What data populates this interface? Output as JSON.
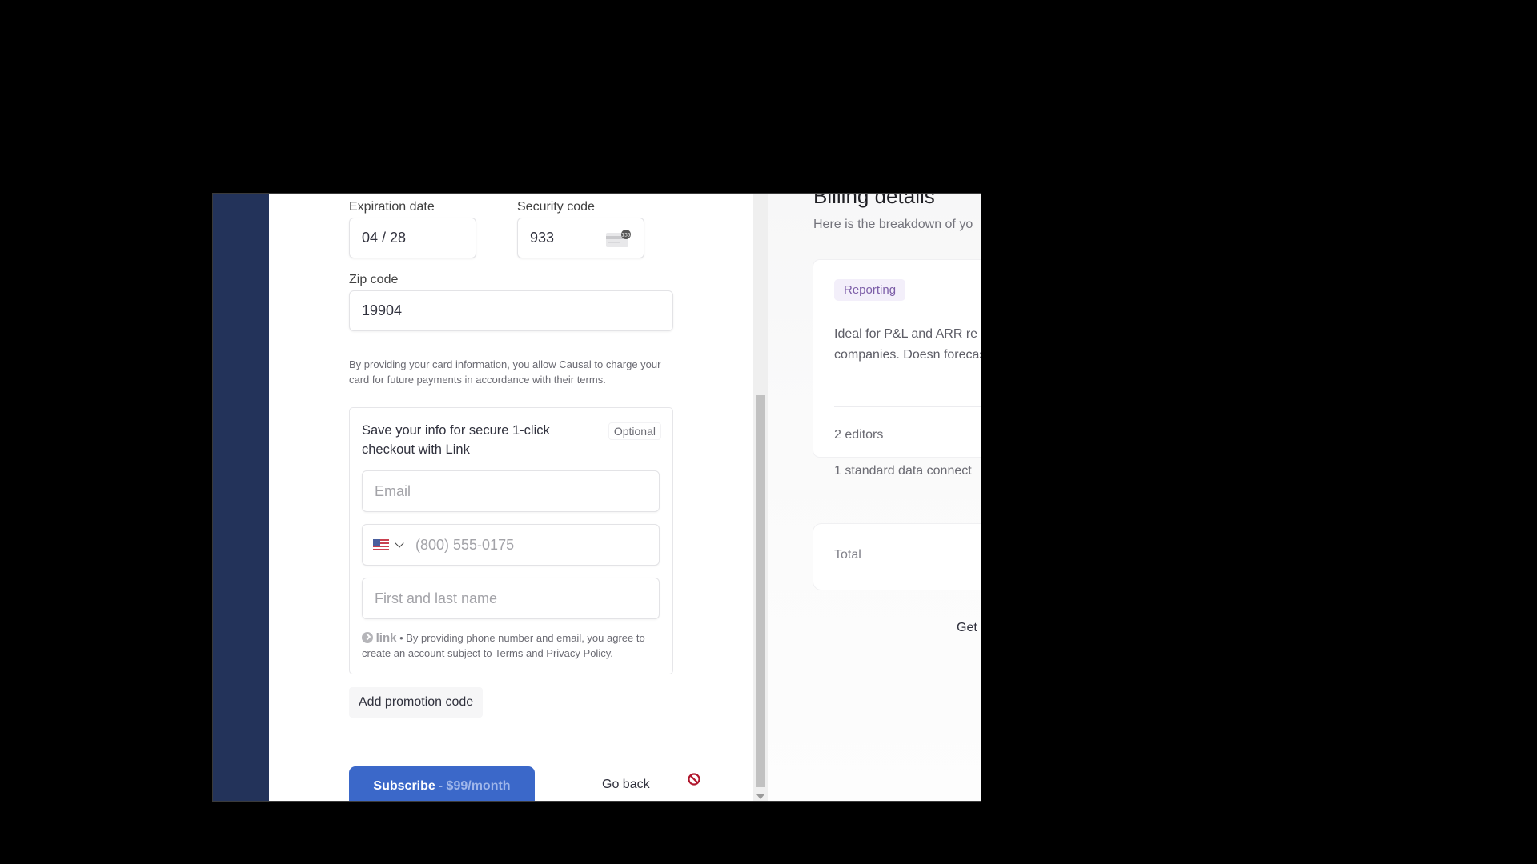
{
  "payment_form": {
    "expiration": {
      "label": "Expiration date",
      "value": "04 / 28"
    },
    "security_code": {
      "label": "Security code",
      "value": "933",
      "icon": "cvc-card-icon",
      "icon_badge": "135"
    },
    "zip": {
      "label": "Zip code",
      "value": "19904"
    },
    "disclaimer": "By providing your card information, you allow Causal to charge your card for future payments in accordance with their terms.",
    "link": {
      "title": "Save your info for secure 1-click checkout with Link",
      "optional_label": "Optional",
      "email_placeholder": "Email",
      "phone_country": "US",
      "phone_placeholder": "(800) 555-0175",
      "name_placeholder": "First and last name",
      "logo_text": "link",
      "legal_prefix": " • By providing phone number and email, you agree to create an account subject to ",
      "terms_label": "Terms",
      "and_label": " and ",
      "privacy_label": "Privacy Policy",
      "legal_suffix": "."
    },
    "promo_label": "Add promotion code",
    "subscribe_label": "Subscribe",
    "subscribe_price": "- $99/month",
    "go_back_label": "Go back"
  },
  "billing": {
    "title": "Billing details",
    "subtitle": "Here is the breakdown of yo",
    "plan": {
      "badge": "Reporting",
      "description": "Ideal for P&L and ARR re stage companies. Doesn forecasting.",
      "features": [
        "2 editors",
        "1 standard data connect"
      ]
    },
    "total_label": "Total",
    "get_label": "Get"
  },
  "colors": {
    "sidebar": "#23335a",
    "primary_button": "#3b68c9",
    "badge_bg": "#f3effa",
    "badge_text": "#7d5fa8"
  }
}
